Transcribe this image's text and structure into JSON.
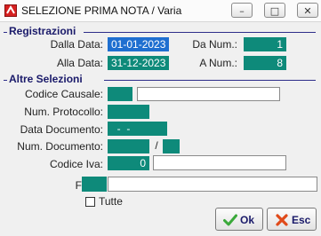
{
  "window": {
    "title": "SELEZIONE PRIMA NOTA / Varia",
    "minimize": "–",
    "maximize": "□",
    "close": "✕"
  },
  "registrazioni": {
    "title": "Registrazioni",
    "dalla_data_label": "Dalla Data:",
    "dalla_data_value": "01-01-2023",
    "alla_data_label": "Alla  Data:",
    "alla_data_value": "31-12-2023",
    "da_num_label": "Da Num.:",
    "da_num_value": "1",
    "a_num_label": "A Num.:",
    "a_num_value": "8"
  },
  "altre_selezioni": {
    "title": "Altre Selezioni",
    "codice_causale_label": "Codice Causale:",
    "codice_causale_value": "",
    "codice_causale_desc": "",
    "num_protocollo_label": "Num. Protocollo:",
    "num_protocollo_value": "",
    "data_documento_label": "Data Documento:",
    "data_documento_value": "  -  -",
    "num_documento_label": "Num. Documento:",
    "num_documento_value": "",
    "num_documento_sep": "/",
    "num_documento_suffix": "",
    "codice_iva_label": "Codice Iva:",
    "codice_iva_value": "0",
    "codice_iva_desc": ""
  },
  "filiale": {
    "label": "Filiale",
    "value": "",
    "desc": ""
  },
  "tutte": {
    "label": "Tutte",
    "checked": false
  },
  "buttons": {
    "ok_label": "Ok",
    "esc_label": "Esc"
  },
  "colors": {
    "field_bg": "#0e8a7a",
    "selected_bg": "#1f6fd0",
    "section_title": "#1a1a6a"
  }
}
